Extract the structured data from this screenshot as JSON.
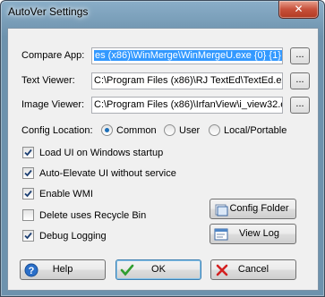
{
  "window": {
    "title": "AutoVer Settings",
    "close_glyph": "✕"
  },
  "fields": {
    "compare_app": {
      "label": "Compare App:",
      "value": "es (x86)\\WinMerge\\WinMergeU.exe {0} {1}"
    },
    "text_viewer": {
      "label": "Text Viewer:",
      "value": "C:\\Program Files (x86)\\RJ TextEd\\TextEd.ex"
    },
    "image_viewer": {
      "label": "Image Viewer:",
      "value": "C:\\Program Files (x86)\\IrfanView\\i_view32.e"
    },
    "browse_label": "..."
  },
  "config_location": {
    "label": "Config Location:",
    "options": [
      {
        "label": "Common",
        "selected": true
      },
      {
        "label": "User",
        "selected": false
      },
      {
        "label": "Local/Portable",
        "selected": false
      }
    ]
  },
  "checkboxes": [
    {
      "label": "Load UI on Windows startup",
      "checked": true
    },
    {
      "label": "Auto-Elevate UI without service",
      "checked": true
    },
    {
      "label": "Enable WMI",
      "checked": true
    },
    {
      "label": "Delete uses Recycle Bin",
      "checked": false
    },
    {
      "label": "Debug Logging",
      "checked": true
    }
  ],
  "side_buttons": {
    "config_folder": "Config Folder",
    "view_log": "View Log"
  },
  "footer": {
    "help": "Help",
    "ok": "OK",
    "cancel": "Cancel"
  },
  "colors": {
    "accent": "#3399ff",
    "ok_green": "#2f9e2f",
    "cancel_red": "#d42020",
    "help_blue": "#2a6fc9"
  }
}
